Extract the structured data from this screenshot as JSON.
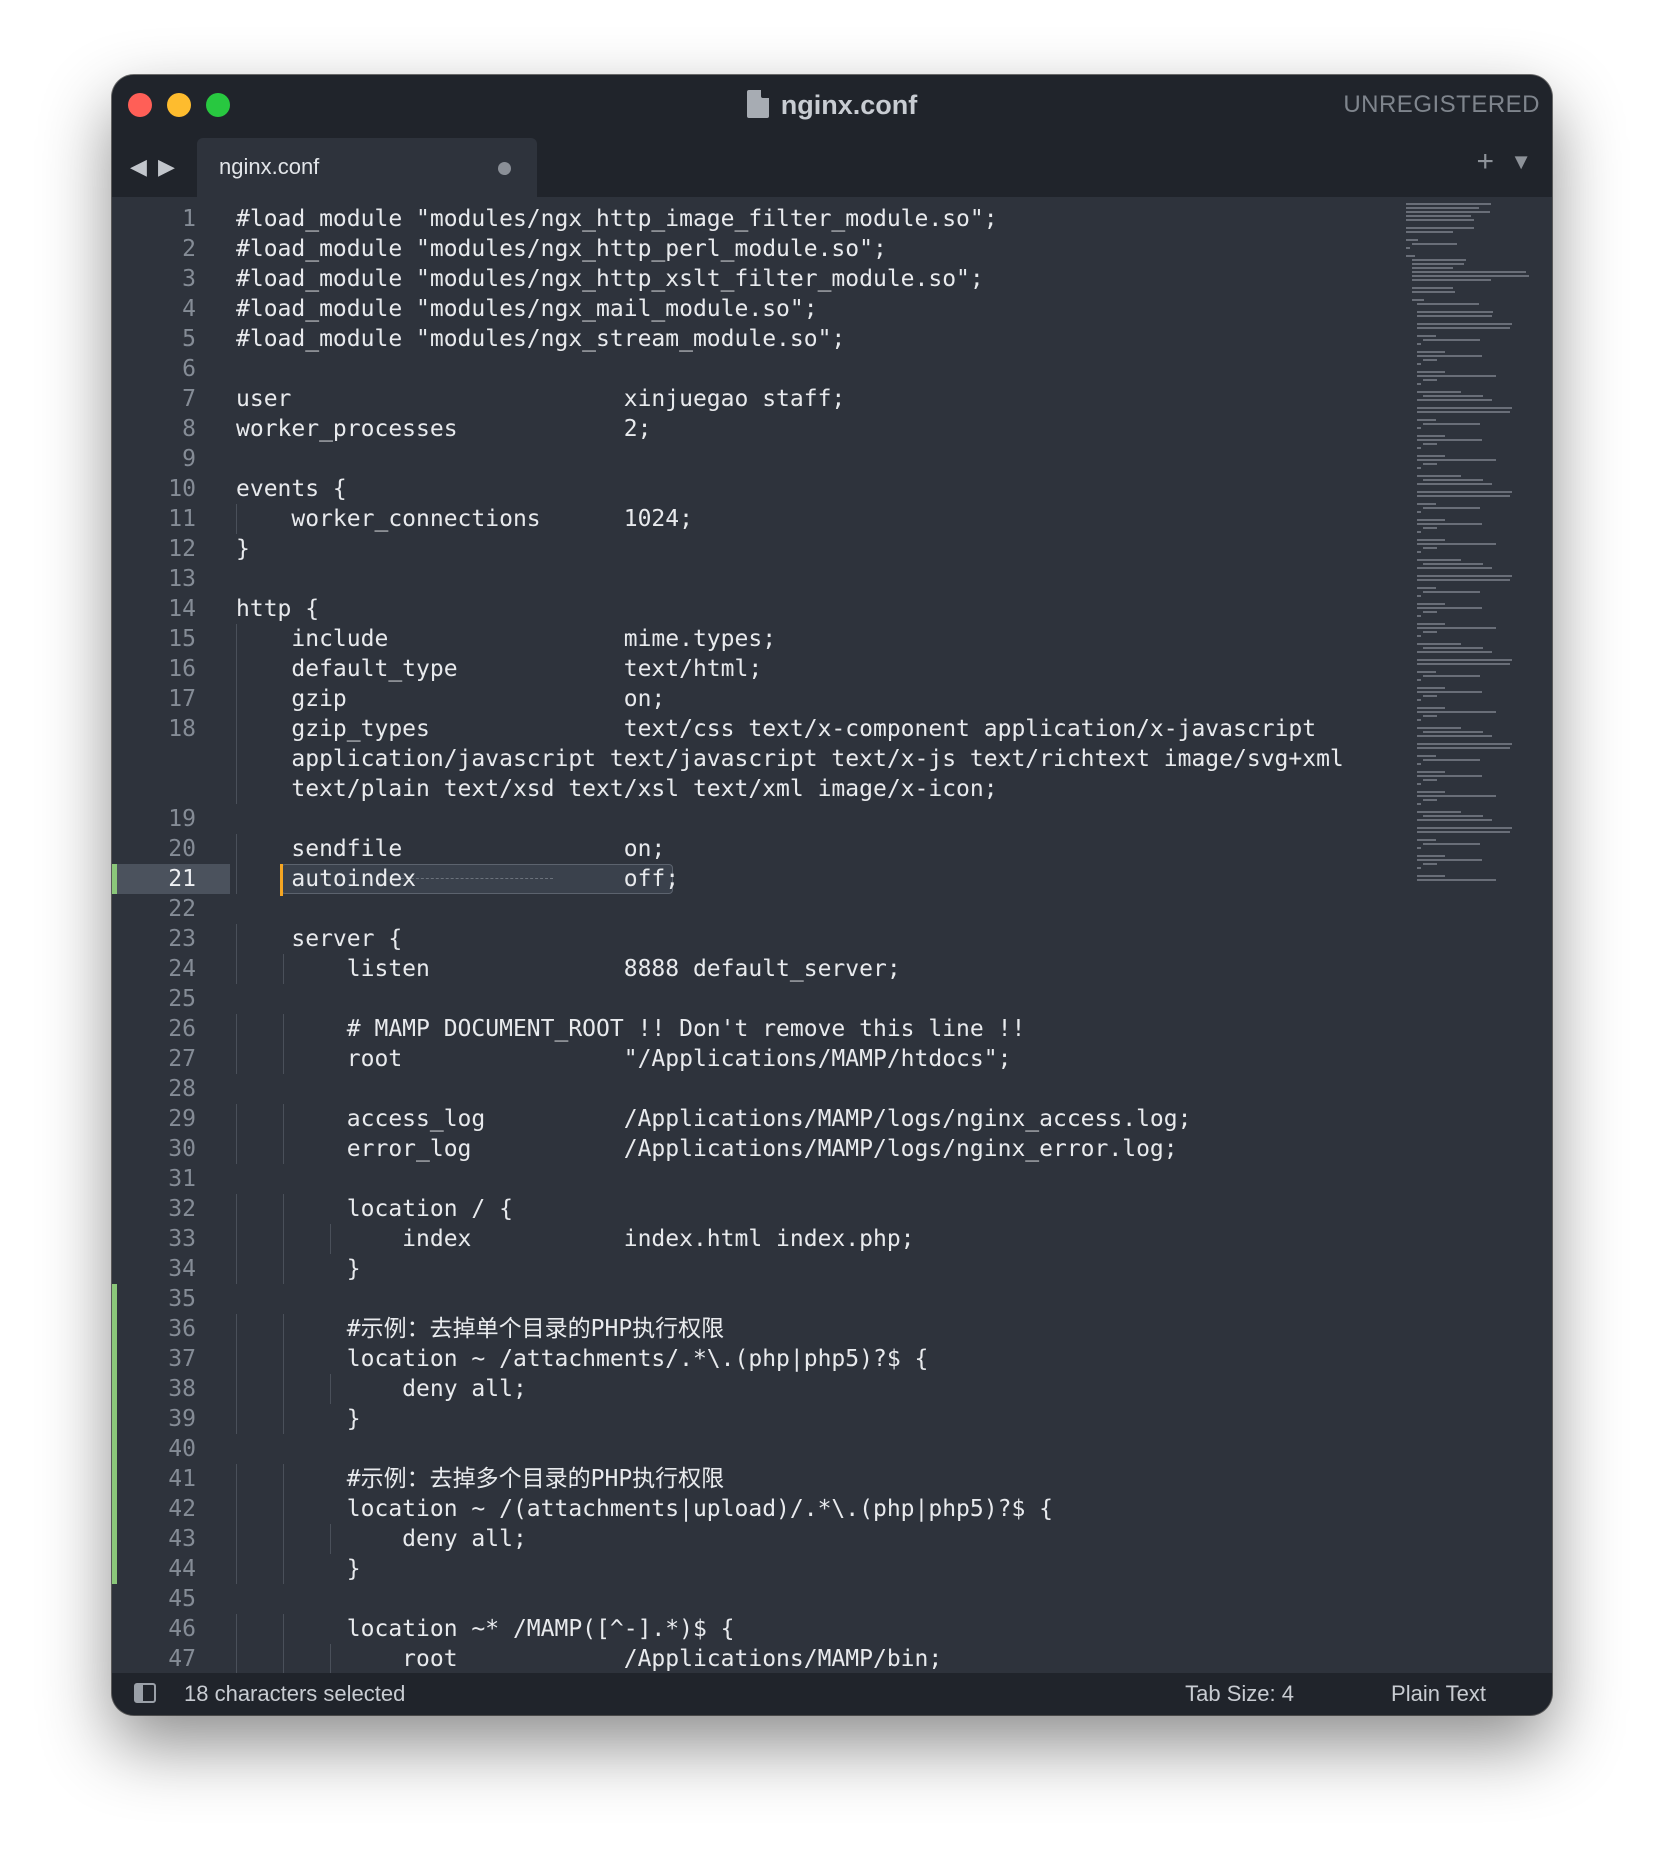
{
  "window": {
    "title": "nginx.conf",
    "registration": "UNREGISTERED"
  },
  "nav": {
    "back": "◀",
    "forward": "▶"
  },
  "tab": {
    "label": "nginx.conf",
    "add": "+",
    "menu": "▼"
  },
  "editor": {
    "current_line": 21,
    "modified_lines": [
      21,
      35,
      36,
      37,
      38,
      39,
      40,
      41,
      42,
      43,
      44
    ],
    "lines": [
      {
        "n": "1",
        "text": "#load_module \"modules/ngx_http_image_filter_module.so\";"
      },
      {
        "n": "2",
        "text": "#load_module \"modules/ngx_http_perl_module.so\";"
      },
      {
        "n": "3",
        "text": "#load_module \"modules/ngx_http_xslt_filter_module.so\";"
      },
      {
        "n": "4",
        "text": "#load_module \"modules/ngx_mail_module.so\";"
      },
      {
        "n": "5",
        "text": "#load_module \"modules/ngx_stream_module.so\";"
      },
      {
        "n": "6",
        "text": ""
      },
      {
        "n": "7",
        "text": "user                        xinjuegao staff;"
      },
      {
        "n": "8",
        "text": "worker_processes            2;"
      },
      {
        "n": "9",
        "text": ""
      },
      {
        "n": "10",
        "text": "events {"
      },
      {
        "n": "11",
        "text": "    worker_connections      1024;"
      },
      {
        "n": "12",
        "text": "}"
      },
      {
        "n": "13",
        "text": ""
      },
      {
        "n": "14",
        "text": "http {"
      },
      {
        "n": "15",
        "text": "    include                 mime.types;"
      },
      {
        "n": "16",
        "text": "    default_type            text/html;"
      },
      {
        "n": "17",
        "text": "    gzip                    on;"
      },
      {
        "n": "18",
        "text": "    gzip_types              text/css text/x-component application/x-javascript"
      },
      {
        "n": "",
        "text": "    application/javascript text/javascript text/x-js text/richtext image/svg+xml"
      },
      {
        "n": "",
        "text": "    text/plain text/xsd text/xsl text/xml image/x-icon;"
      },
      {
        "n": "19",
        "text": ""
      },
      {
        "n": "20",
        "text": "    sendfile                on;"
      },
      {
        "n": "21",
        "text": "    autoindex               off;"
      },
      {
        "n": "22",
        "text": ""
      },
      {
        "n": "23",
        "text": "    server {"
      },
      {
        "n": "24",
        "text": "        listen              8888 default_server;"
      },
      {
        "n": "25",
        "text": ""
      },
      {
        "n": "26",
        "text": "        # MAMP DOCUMENT_ROOT !! Don't remove this line !!"
      },
      {
        "n": "27",
        "text": "        root                \"/Applications/MAMP/htdocs\";"
      },
      {
        "n": "28",
        "text": ""
      },
      {
        "n": "29",
        "text": "        access_log          /Applications/MAMP/logs/nginx_access.log;"
      },
      {
        "n": "30",
        "text": "        error_log           /Applications/MAMP/logs/nginx_error.log;"
      },
      {
        "n": "31",
        "text": ""
      },
      {
        "n": "32",
        "text": "        location / {"
      },
      {
        "n": "33",
        "text": "            index           index.html index.php;"
      },
      {
        "n": "34",
        "text": "        }"
      },
      {
        "n": "35",
        "text": ""
      },
      {
        "n": "36",
        "text": "        #示例：去掉单个目录的PHP执行权限"
      },
      {
        "n": "37",
        "text": "        location ~ /attachments/.*\\.(php|php5)?$ {"
      },
      {
        "n": "38",
        "text": "            deny all;"
      },
      {
        "n": "39",
        "text": "        }"
      },
      {
        "n": "40",
        "text": ""
      },
      {
        "n": "41",
        "text": "        #示例：去掉多个目录的PHP执行权限"
      },
      {
        "n": "42",
        "text": "        location ~ /(attachments|upload)/.*\\.(php|php5)?$ {"
      },
      {
        "n": "43",
        "text": "            deny all;"
      },
      {
        "n": "44",
        "text": "        }"
      },
      {
        "n": "45",
        "text": ""
      },
      {
        "n": "46",
        "text": "        location ~* /MAMP([^-].*)$ {"
      },
      {
        "n": "47",
        "text": "            root            /Applications/MAMP/bin;"
      }
    ]
  },
  "status": {
    "selection": "18 characters selected",
    "tab_size": "Tab Size: 4",
    "syntax": "Plain Text"
  },
  "colors": {
    "background": "#2e333c",
    "chrome": "#20242b",
    "text": "#e8eaed",
    "line_number": "#858c96",
    "modified_marker": "#8bc77a",
    "caret": "#f5a623"
  }
}
